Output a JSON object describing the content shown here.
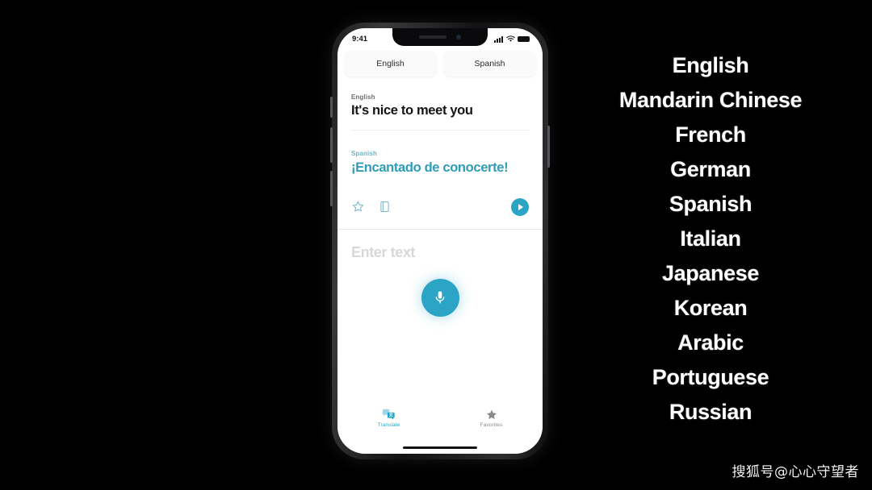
{
  "background_color": "#000000",
  "accent_color": "#2BA4C6",
  "phone": {
    "status_bar": {
      "time": "9:41",
      "signal_icon": "cellular-signal-icon",
      "wifi_icon": "wifi-icon",
      "battery_icon": "battery-icon"
    },
    "language_selector": {
      "source": "English",
      "target": "Spanish"
    },
    "translation_card": {
      "source_label": "English",
      "source_text": "It's nice to meet you",
      "target_label": "Spanish",
      "target_text": "¡Encantado de conocerte!",
      "target_color": "#2F9CB8",
      "target_label_color": "#6FB4C4",
      "actions": {
        "favorite_icon": "star-outline-icon",
        "dictionary_icon": "dictionary-book-icon",
        "play_icon": "play-circle-icon"
      }
    },
    "input_area": {
      "placeholder": "Enter text",
      "mic_icon": "microphone-icon"
    },
    "tab_bar": {
      "tabs": [
        {
          "label": "Translate",
          "icon": "translate-bubbles-icon",
          "active": true
        },
        {
          "label": "Favorites",
          "icon": "star-filled-icon",
          "active": false
        }
      ]
    }
  },
  "language_list": {
    "items": [
      "English",
      "Mandarin Chinese",
      "French",
      "German",
      "Spanish",
      "Italian",
      "Japanese",
      "Korean",
      "Arabic",
      "Portuguese",
      "Russian"
    ]
  },
  "watermark": "搜狐号@心心守望者"
}
